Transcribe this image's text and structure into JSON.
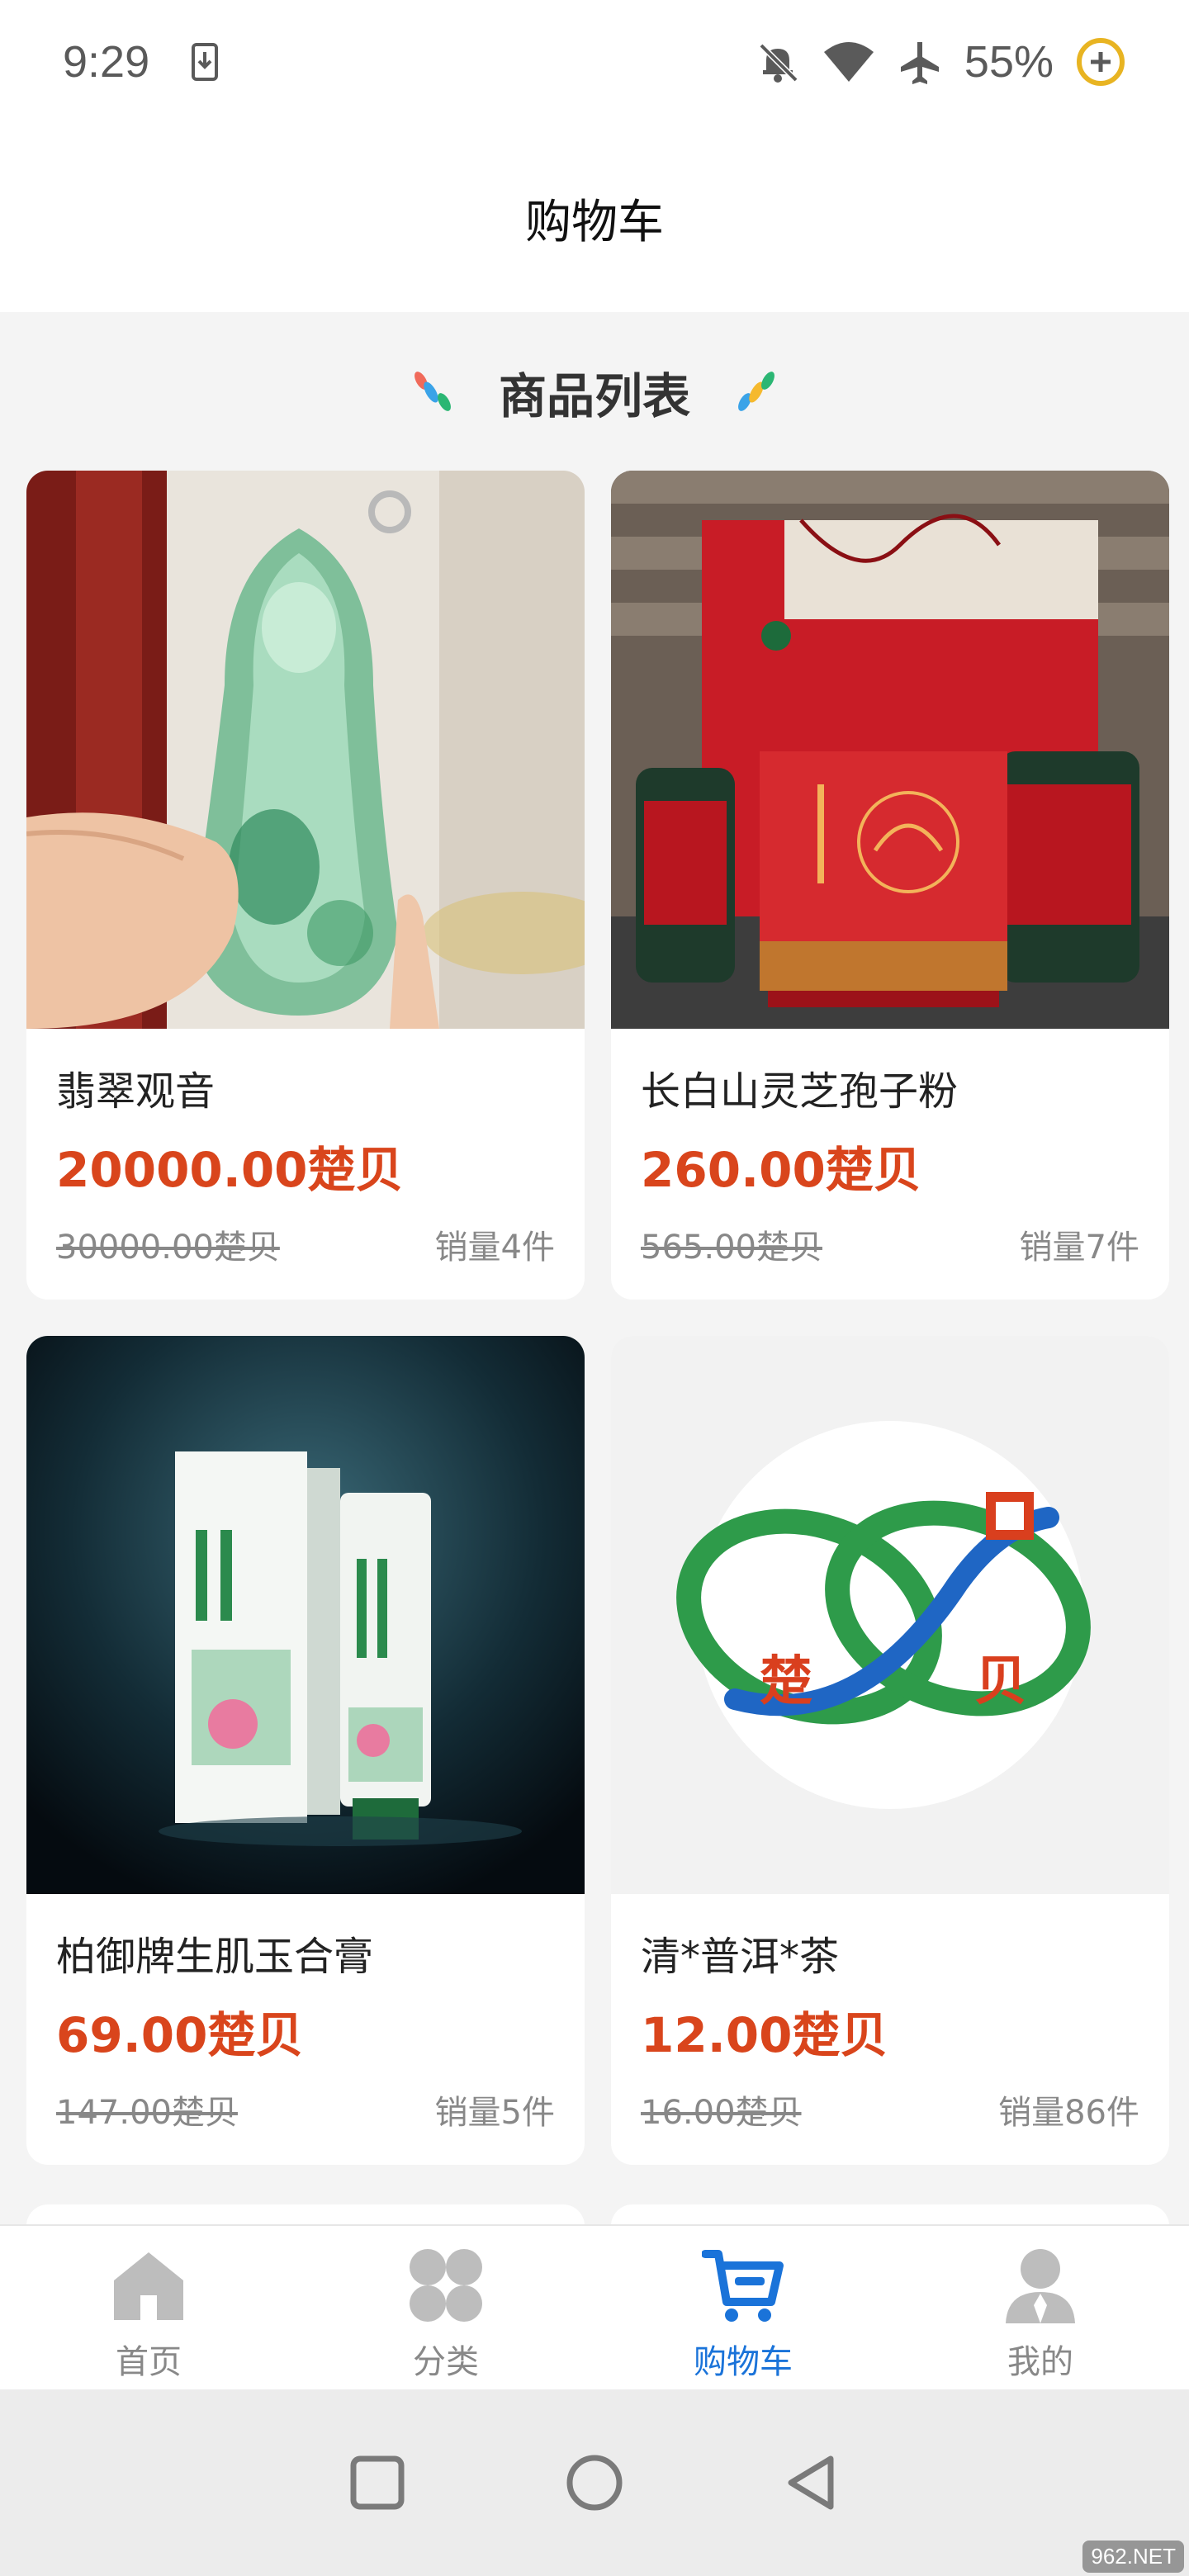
{
  "status_bar": {
    "time": "9:29",
    "battery": "55%"
  },
  "header": {
    "title": "购物车"
  },
  "section": {
    "title": "商品列表"
  },
  "products": [
    {
      "name": "翡翠观音",
      "price": "20000.00楚贝",
      "original_price": "30000.00楚贝",
      "sales": "销量4件"
    },
    {
      "name": "长白山灵芝孢子粉",
      "price": "260.00楚贝",
      "original_price": "565.00楚贝",
      "sales": "销量7件"
    },
    {
      "name": "柏御牌生肌玉合膏",
      "price": "69.00楚贝",
      "original_price": "147.00楚贝",
      "sales": "销量5件"
    },
    {
      "name": "清*普洱*茶",
      "price": "12.00楚贝",
      "original_price": "16.00楚贝",
      "sales": "销量86件"
    }
  ],
  "product_images": {
    "logo_text_left": "楚",
    "logo_text_right": "贝"
  },
  "tabbar": {
    "items": [
      {
        "label": "首页",
        "icon": "home-icon"
      },
      {
        "label": "分类",
        "icon": "category-icon"
      },
      {
        "label": "购物车",
        "icon": "cart-icon"
      },
      {
        "label": "我的",
        "icon": "user-icon"
      }
    ],
    "active_color": "#1a73d9",
    "inactive_color": "#bdbdbd"
  },
  "watermark": "962.NET",
  "colors": {
    "price": "#d9451c",
    "background": "#f4f4f4"
  }
}
